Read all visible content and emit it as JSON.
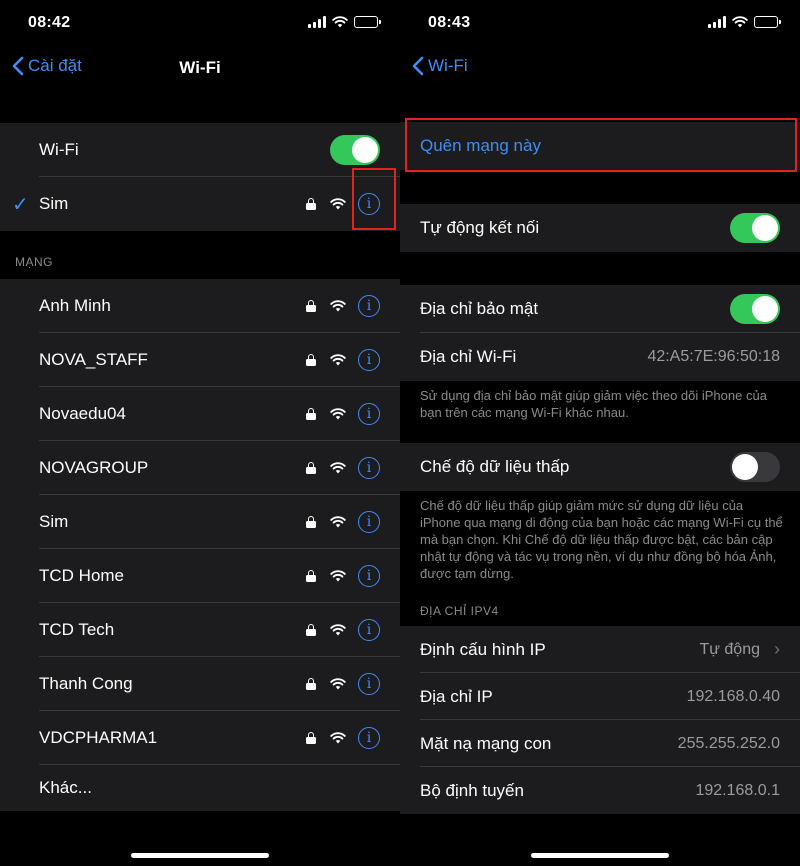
{
  "left": {
    "status_time": "08:42",
    "nav": {
      "back_label": "Cài đặt",
      "title": "Wi-Fi"
    },
    "wifi_row": {
      "label": "Wi-Fi",
      "on": true
    },
    "connected": {
      "name": "Sim"
    },
    "section_label": "MẠNG",
    "networks": [
      {
        "name": "Anh Minh"
      },
      {
        "name": "NOVA_STAFF"
      },
      {
        "name": "Novaedu04"
      },
      {
        "name": "NOVAGROUP"
      },
      {
        "name": "Sim"
      },
      {
        "name": "TCD Home"
      },
      {
        "name": "TCD Tech"
      },
      {
        "name": "Thanh Cong"
      },
      {
        "name": "VDCPHARMA1"
      }
    ],
    "other_label": "Khác..."
  },
  "right": {
    "status_time": "08:43",
    "nav": {
      "back_label": "Wi-Fi"
    },
    "forget_label": "Quên mạng này",
    "auto_join": {
      "label": "Tự động kết nối",
      "on": true
    },
    "private_address": {
      "label": "Địa chỉ bảo mật",
      "on": true
    },
    "wifi_address": {
      "label": "Địa chỉ Wi-Fi",
      "value": "42:A5:7E:96:50:18"
    },
    "private_note": "Sử dụng địa chỉ bảo mật giúp giảm việc theo dõi iPhone của bạn trên các mạng Wi-Fi khác nhau.",
    "low_data": {
      "label": "Chế độ dữ liệu thấp",
      "on": false
    },
    "low_data_note": "Chế độ dữ liệu thấp giúp giảm mức sử dụng dữ liệu của iPhone qua mạng di động của bạn hoặc các mạng Wi-Fi cụ thể mà bạn chọn. Khi Chế độ dữ liệu thấp được bật, các bản cập nhật tự động và tác vụ trong nền, ví dụ như đồng bộ hóa Ảnh, được tạm dừng.",
    "ipv4_label": "ĐỊA CHỈ IPV4",
    "configure_ip": {
      "label": "Định cấu hình IP",
      "value": "Tự động"
    },
    "ip_address": {
      "label": "Địa chỉ IP",
      "value": "192.168.0.40"
    },
    "subnet_mask": {
      "label": "Mặt nạ mạng con",
      "value": "255.255.252.0"
    },
    "router": {
      "label": "Bộ định tuyến",
      "value": "192.168.0.1"
    }
  },
  "colors": {
    "accent": "#3d8ef5",
    "toggle_on": "#34c759",
    "highlight": "#e3231d",
    "cell": "#1c1c1e"
  }
}
